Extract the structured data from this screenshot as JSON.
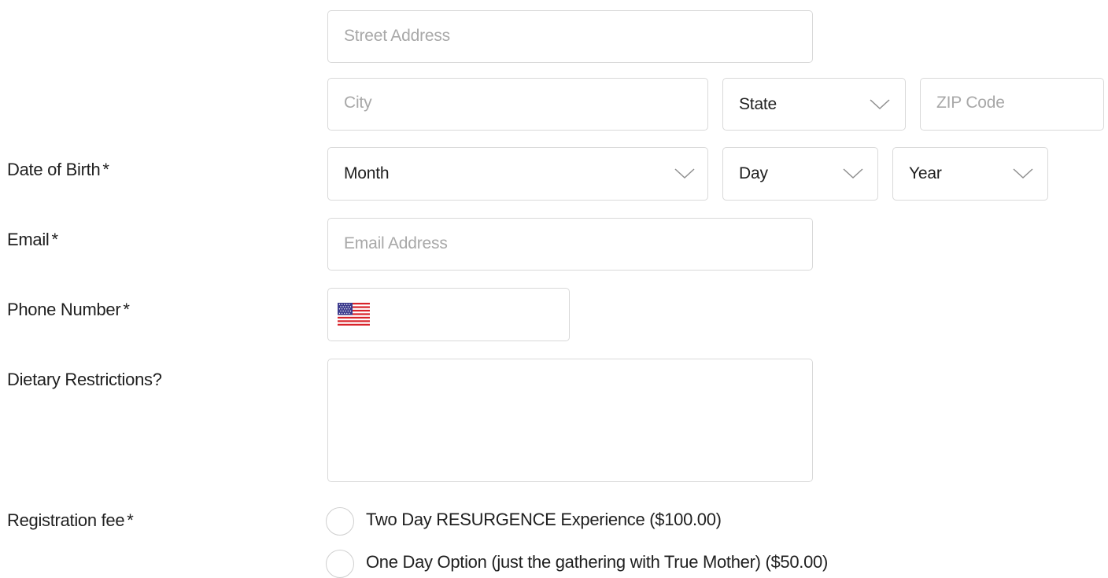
{
  "address": {
    "street_placeholder": "Street Address",
    "city_placeholder": "City",
    "state_selected": "State",
    "zip_placeholder": "ZIP Code"
  },
  "dob": {
    "label": "Date of Birth",
    "required_mark": "*",
    "month_selected": "Month",
    "day_selected": "Day",
    "year_selected": "Year"
  },
  "email": {
    "label": "Email",
    "required_mark": "*",
    "placeholder": "Email Address"
  },
  "phone": {
    "label": "Phone Number",
    "required_mark": "*",
    "country_flag_icon": "us-flag-icon",
    "value": ""
  },
  "dietary": {
    "label": "Dietary Restrictions?",
    "value": ""
  },
  "registration": {
    "label": "Registration fee",
    "required_mark": "*",
    "options": [
      {
        "label": "Two Day RESURGENCE Experience ($100.00)",
        "selected": false
      },
      {
        "label": "One Day Option (just the gathering with True Mother) ($50.00)",
        "selected": false
      }
    ]
  },
  "icons": {
    "select_chevron": "chevron-down-icon",
    "radio": "radio-circle-icon"
  },
  "colors": {
    "border": "#d9d9d9",
    "placeholder": "#a8a8a8",
    "text": "#1f1f1f",
    "chevron": "#8f8f8f"
  }
}
